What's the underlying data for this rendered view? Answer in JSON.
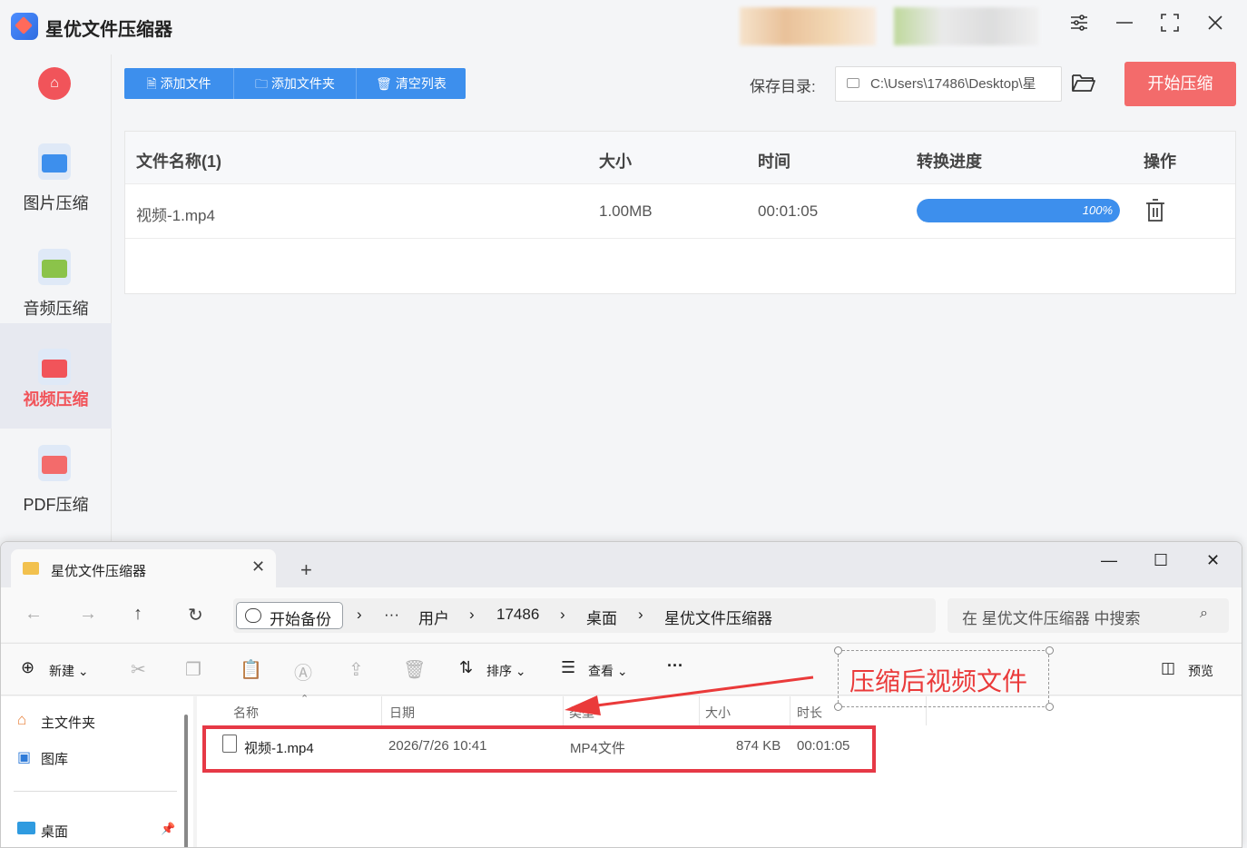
{
  "app": {
    "title": "星优文件压缩器",
    "accent": "#3d8fed",
    "danger": "#f36b6b"
  },
  "sidebar": {
    "items": [
      {
        "label": "图片压缩",
        "icon": "image-icon"
      },
      {
        "label": "音频压缩",
        "icon": "music-icon"
      },
      {
        "label": "视频压缩",
        "icon": "video-icon",
        "active": true
      },
      {
        "label": "PDF压缩",
        "icon": "pdf-icon"
      }
    ]
  },
  "toolbar": {
    "add_file": "添加文件",
    "add_folder": "添加文件夹",
    "clear_list": "清空列表",
    "save_label": "保存目录:",
    "save_path": "C:\\Users\\17486\\Desktop\\星",
    "start": "开始压缩"
  },
  "table": {
    "headers": [
      "文件名称(1)",
      "大小",
      "时间",
      "转换进度",
      "操作"
    ],
    "rows": [
      {
        "name": "视频-1.mp4",
        "size": "1.00MB",
        "time": "00:01:05",
        "progress_label": "100%",
        "progress": 1.0
      }
    ]
  },
  "explorer": {
    "tab_title": "星优文件压缩器",
    "backup_label": "开始备份",
    "ellipsis": "···",
    "breadcrumb": [
      "用户",
      "17486",
      "桌面",
      "星优文件压缩器"
    ],
    "search_placeholder": "在 星优文件压缩器 中搜索",
    "cmd": {
      "new": "新建",
      "sort": "排序",
      "view": "查看",
      "more": "···",
      "preview": "预览"
    },
    "left_items": [
      "主文件夹",
      "图库",
      "桌面"
    ],
    "columns": [
      "名称",
      "日期",
      "类型",
      "大小",
      "时长"
    ],
    "files": [
      {
        "name": "视频-1.mp4",
        "date": "2026/7/26 10:41",
        "type": "MP4文件",
        "size": "874 KB",
        "duration": "00:01:05"
      }
    ]
  },
  "annotation": {
    "text": "压缩后视频文件"
  }
}
